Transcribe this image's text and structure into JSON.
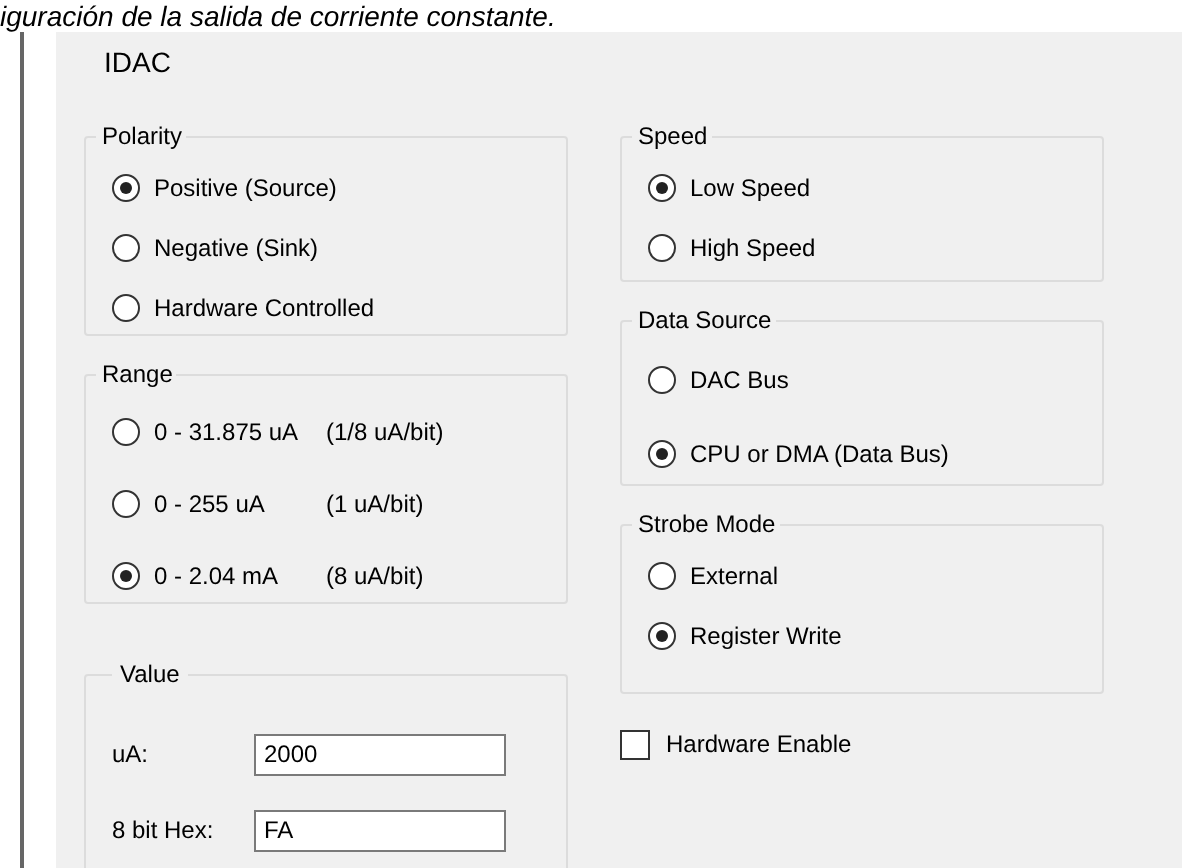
{
  "caption": "iguración de la salida de corriente constante.",
  "panel": {
    "title": "IDAC"
  },
  "left_groups": [
    {
      "title": "Polarity",
      "options": [
        {
          "label": "Positive (Source)",
          "selected": true
        },
        {
          "label": "Negative (Sink)",
          "selected": false
        },
        {
          "label": "Hardware Controlled",
          "selected": false
        }
      ]
    },
    {
      "title": "Range",
      "options": [
        {
          "label": "0 - 31.875 uA",
          "note": "(1/8 uA/bit)",
          "selected": false
        },
        {
          "label": "0 - 255 uA",
          "note": "(1 uA/bit)",
          "selected": false
        },
        {
          "label": "0 - 2.04 mA",
          "note": "(8 uA/bit)",
          "selected": true
        }
      ]
    }
  ],
  "value": {
    "title": "Value",
    "fields": [
      {
        "label": "uA:",
        "value": "2000"
      },
      {
        "label": "8 bit Hex:",
        "value": "FA"
      }
    ]
  },
  "right_groups": [
    {
      "title": "Speed",
      "options": [
        {
          "label": "Low Speed",
          "selected": true
        },
        {
          "label": "High Speed",
          "selected": false
        }
      ]
    },
    {
      "title": "Data Source",
      "options": [
        {
          "label": "DAC Bus",
          "selected": false
        },
        {
          "label": "CPU or DMA (Data Bus)",
          "selected": true
        }
      ]
    },
    {
      "title": "Strobe Mode",
      "options": [
        {
          "label": "External",
          "selected": false
        },
        {
          "label": "Register Write",
          "selected": true
        }
      ]
    }
  ],
  "hardware_enable": {
    "label": "Hardware Enable",
    "checked": false
  }
}
